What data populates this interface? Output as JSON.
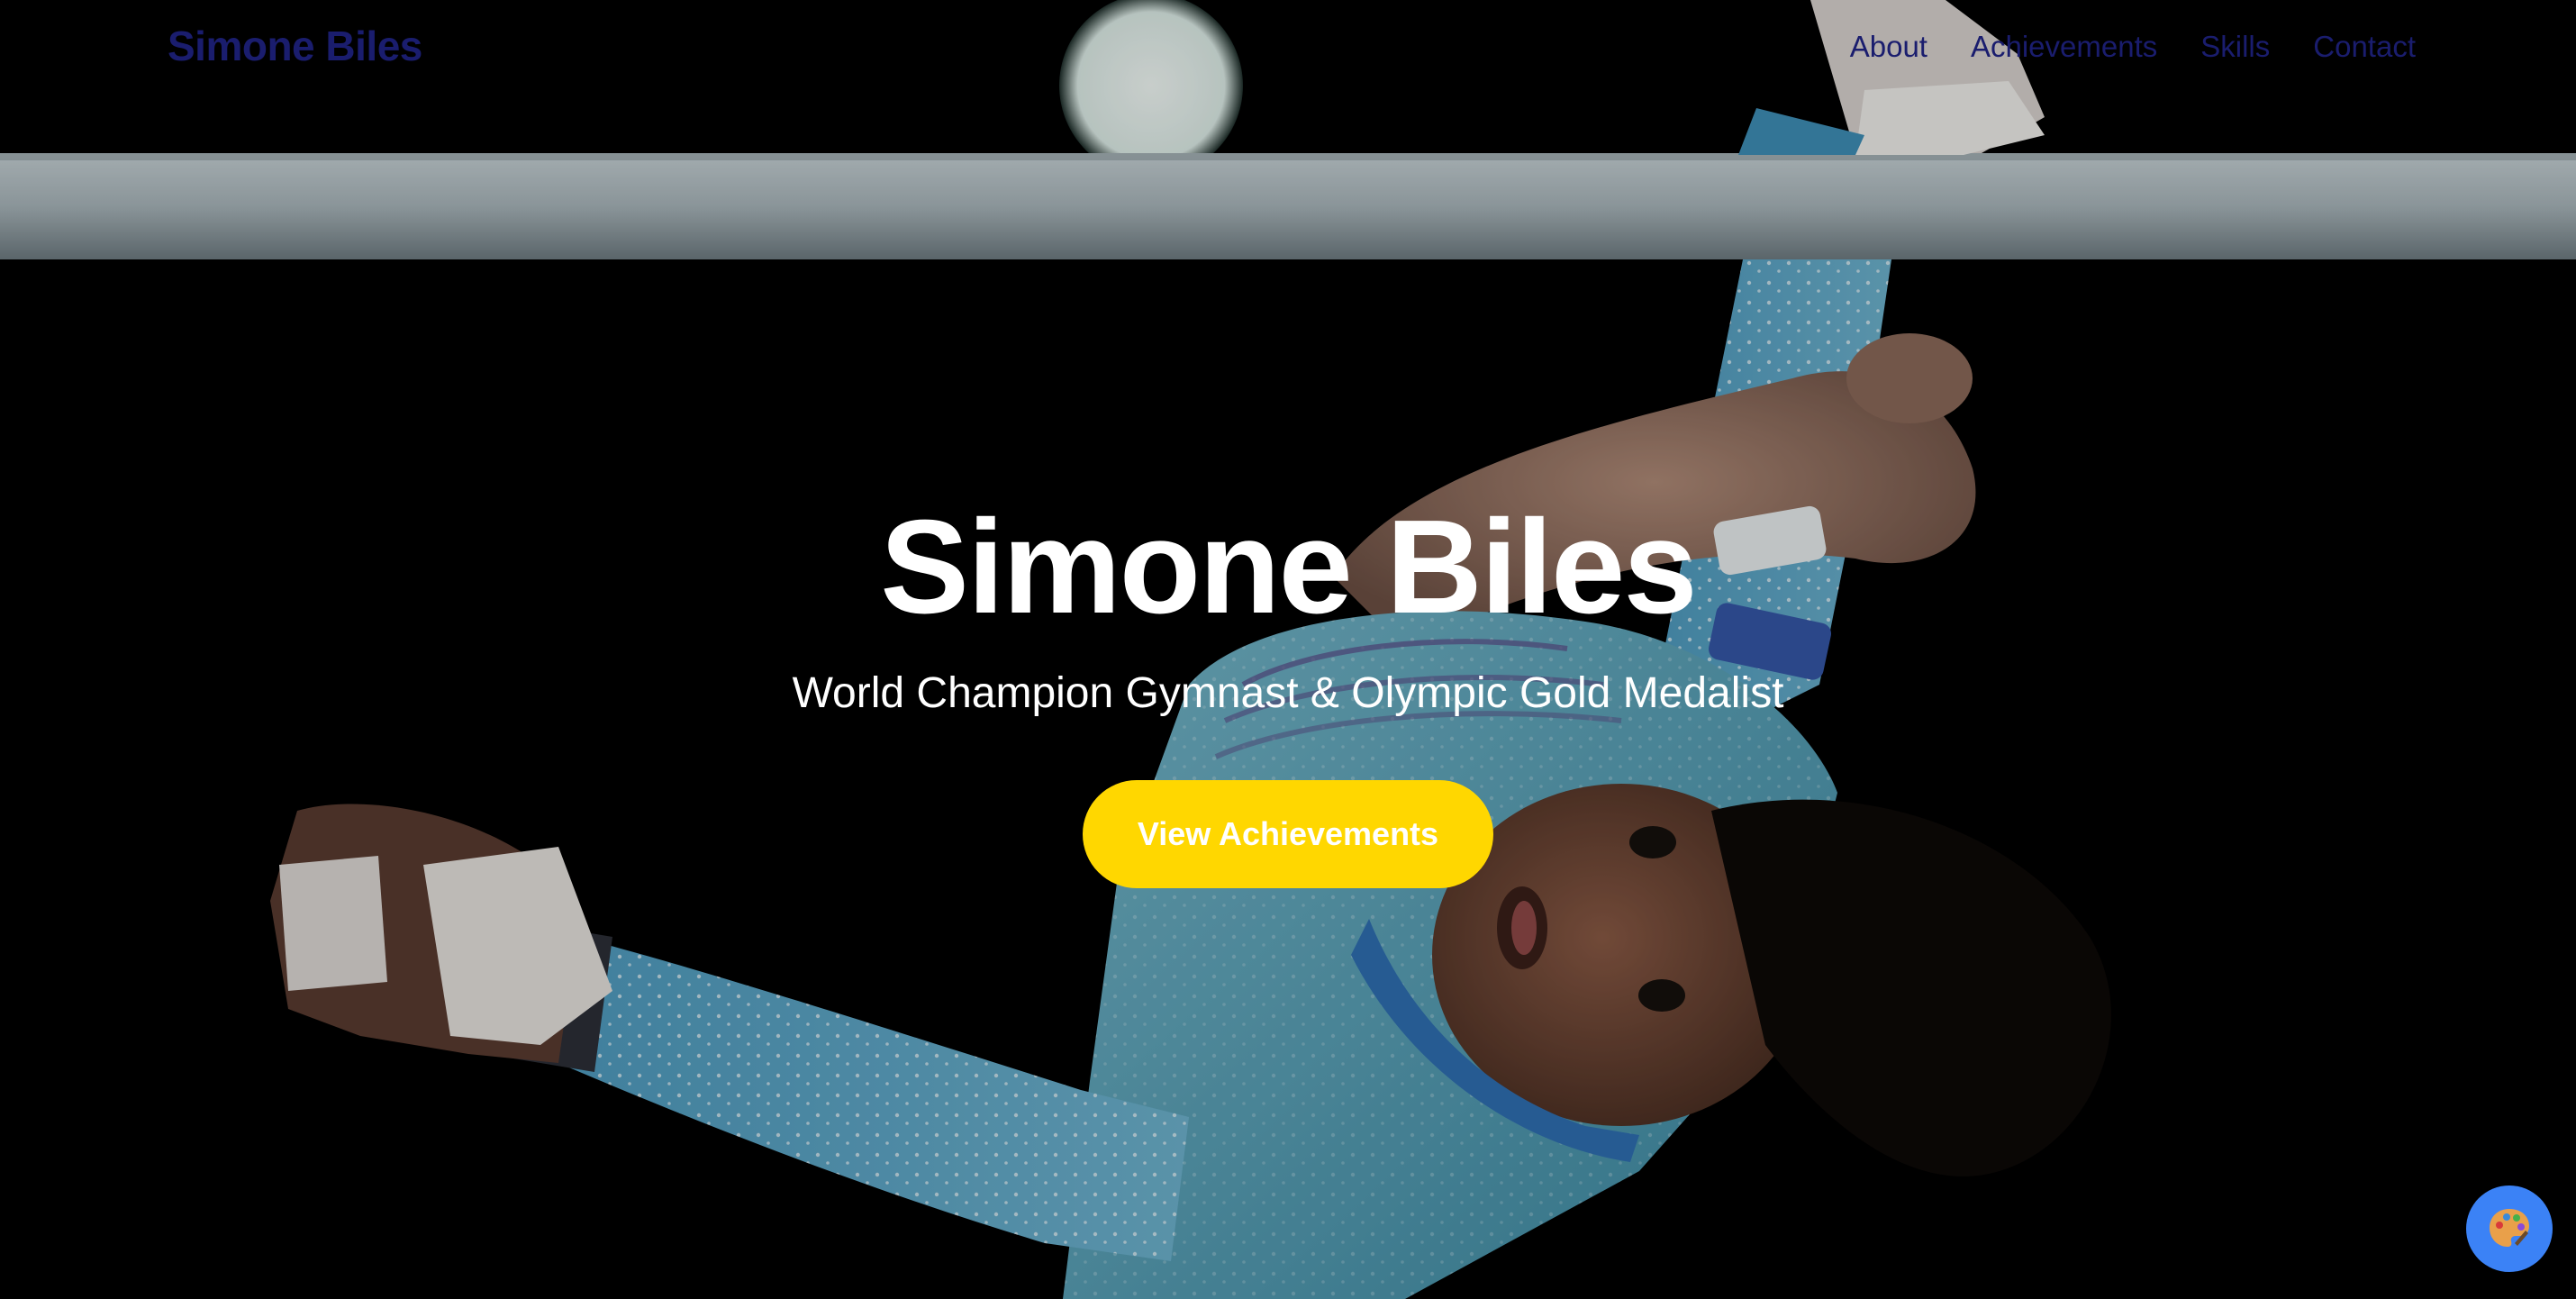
{
  "colors": {
    "nav_text": "#1a1d6e",
    "accent_yellow": "#ffd700",
    "fab_blue": "#3b82f6",
    "hero_text": "#ffffff"
  },
  "nav": {
    "logo": "Simone Biles",
    "links": [
      {
        "label": "About"
      },
      {
        "label": "Achievements"
      },
      {
        "label": "Skills"
      },
      {
        "label": "Contact"
      }
    ]
  },
  "hero": {
    "title": "Simone Biles",
    "subtitle": "World Champion Gymnast & Olympic Gold Medalist",
    "cta_label": "View Achievements",
    "background_image": "gymnast-on-uneven-bars-photo"
  },
  "fab": {
    "icon": "palette-icon"
  }
}
